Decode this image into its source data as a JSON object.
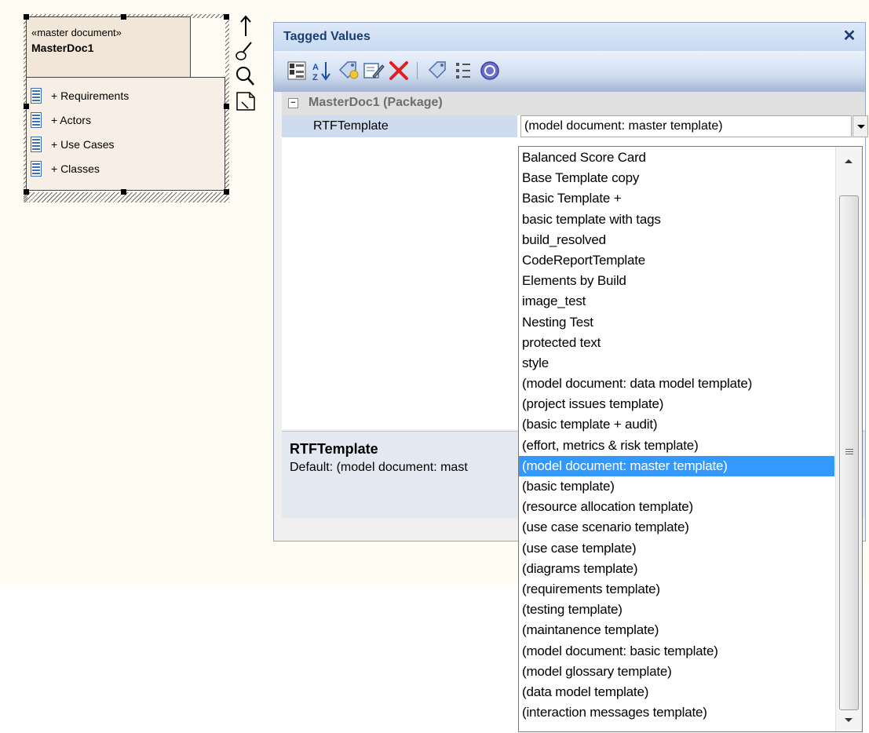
{
  "diagram": {
    "package": {
      "stereotype": "«master document»",
      "name": "MasterDoc1",
      "items": [
        {
          "label": "+ Requirements",
          "icon": "document-icon"
        },
        {
          "label": "+ Actors",
          "icon": "document-icon"
        },
        {
          "label": "+ Use Cases",
          "icon": "document-icon"
        },
        {
          "label": "+ Classes",
          "icon": "document-icon"
        }
      ]
    },
    "quick_tools": [
      "arrow-up-icon",
      "paint-brush-icon",
      "magnifier-icon",
      "note-icon"
    ]
  },
  "tagged_values": {
    "title": "Tagged Values",
    "close_glyph": "✕",
    "toolbar": [
      "group-by-category-icon",
      "sort-alphabetical-icon",
      "new-tag-icon",
      "edit-note-icon",
      "delete-icon",
      "tag-icon",
      "checklist-icon",
      "help-icon"
    ],
    "category": {
      "expander": "−",
      "label": "MasterDoc1 (Package)"
    },
    "property": {
      "name": "RTFTemplate",
      "value": "(model document: master template)"
    },
    "notes": {
      "title": "RTFTemplate",
      "text": "Default: (model document: mast"
    }
  },
  "dropdown": {
    "selected_index": 15,
    "options": [
      "Balanced Score Card",
      "Base Template copy",
      "Basic Template +",
      "basic template with tags",
      "build_resolved",
      "CodeReportTemplate",
      "Elements by Build",
      "image_test",
      "Nesting Test",
      "protected text",
      "style",
      "(model document: data model template)",
      "(project issues template)",
      "(basic template + audit)",
      "(effort, metrics & risk template)",
      "(model document: master template)",
      "(basic template)",
      "(resource allocation template)",
      "(use case scenario template)",
      "(use case template)",
      "(diagrams template)",
      "(requirements template)",
      "(testing template)",
      "(maintanence template)",
      "(model document: basic template)",
      "(model glossary template)",
      "(data model template)",
      "(interaction messages template)"
    ]
  },
  "colors": {
    "selection": "#3399ff",
    "title_text": "#1c3e70",
    "package_fill": "#f2e6d8"
  }
}
